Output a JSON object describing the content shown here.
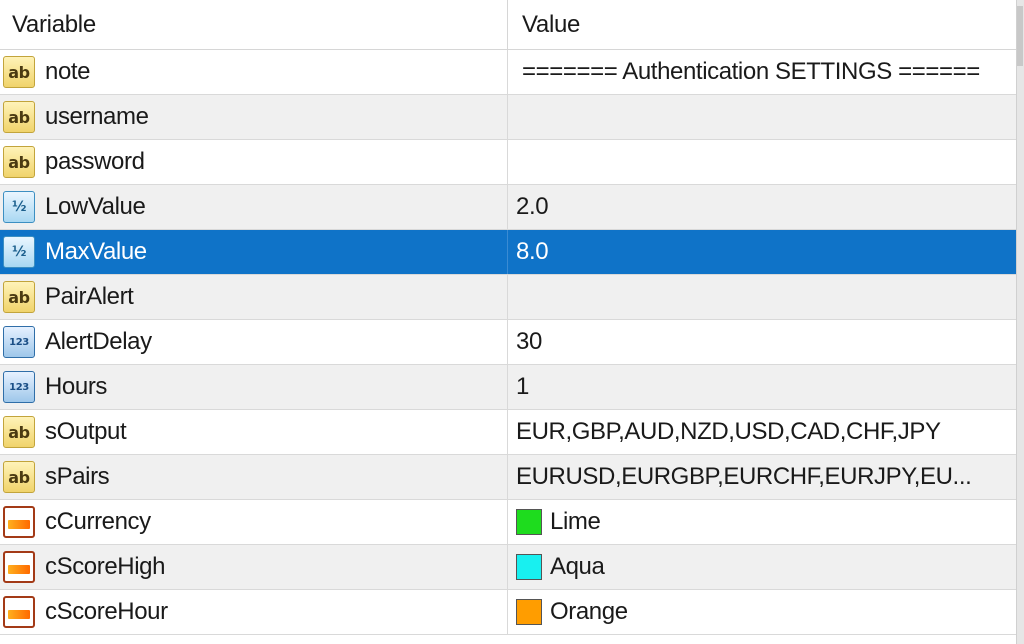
{
  "header": {
    "variable": "Variable",
    "value": "Value"
  },
  "rows": [
    {
      "type": "ab",
      "name": "note",
      "value": "======= Authentication SETTINGS ======"
    },
    {
      "type": "ab",
      "name": "username",
      "value": ""
    },
    {
      "type": "ab",
      "name": "password",
      "value": ""
    },
    {
      "type": "half",
      "name": "LowValue",
      "value": "2.0"
    },
    {
      "type": "half",
      "name": "MaxValue",
      "value": "8.0",
      "selected": true
    },
    {
      "type": "ab",
      "name": "PairAlert",
      "value": ""
    },
    {
      "type": "num",
      "name": "AlertDelay",
      "value": "30"
    },
    {
      "type": "num",
      "name": "Hours",
      "value": "1"
    },
    {
      "type": "ab",
      "name": "sOutput",
      "value": "EUR,GBP,AUD,NZD,USD,CAD,CHF,JPY"
    },
    {
      "type": "ab",
      "name": "sPairs",
      "value": "EURUSD,EURGBP,EURCHF,EURJPY,EU..."
    },
    {
      "type": "color",
      "name": "cCurrency",
      "value": "Lime",
      "swatch": "#1edc1e"
    },
    {
      "type": "color",
      "name": "cScoreHigh",
      "value": "Aqua",
      "swatch": "#18f0f0"
    },
    {
      "type": "color",
      "name": "cScoreHour",
      "value": "Orange",
      "swatch": "#ff9d00"
    }
  ],
  "icons": {
    "ab": "string-type-icon",
    "half": "double-type-icon",
    "num": "integer-type-icon",
    "color": "color-type-icon"
  },
  "colors": {
    "selection": "#0f73c8"
  }
}
